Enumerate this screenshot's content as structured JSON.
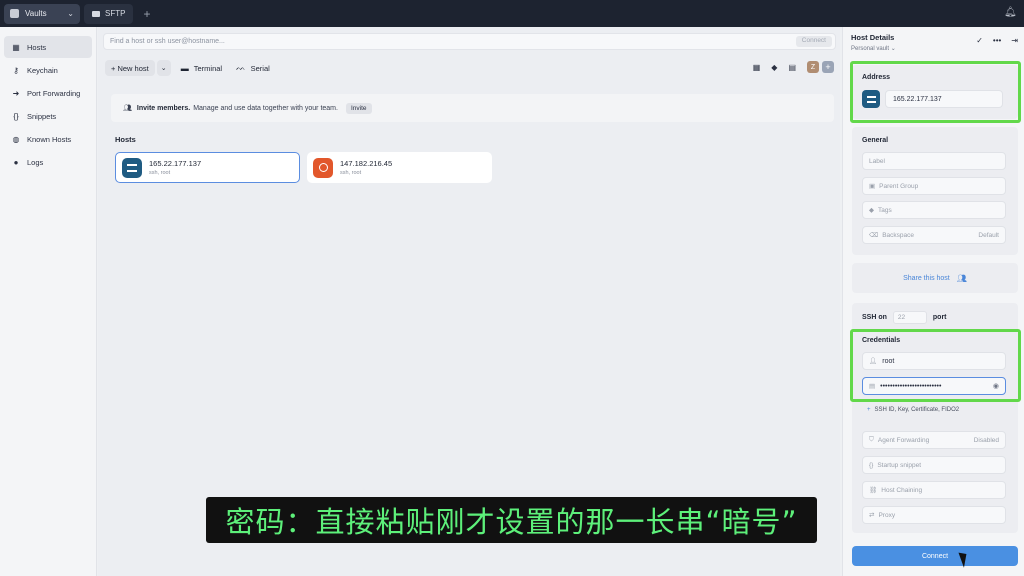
{
  "titlebar": {
    "vault_tab": "Vaults",
    "sftp_tab": "SFTP",
    "add_tab": "+"
  },
  "sidebar": {
    "items": [
      {
        "label": "Hosts",
        "icon": "grid-icon"
      },
      {
        "label": "Keychain",
        "icon": "key-icon"
      },
      {
        "label": "Port Forwarding",
        "icon": "arrow-forward-icon"
      },
      {
        "label": "Snippets",
        "icon": "braces-icon"
      },
      {
        "label": "Known Hosts",
        "icon": "globe-icon"
      },
      {
        "label": "Logs",
        "icon": "clock-icon"
      }
    ]
  },
  "main": {
    "search_placeholder": "Find a host or ssh user@hostname...",
    "search_connect": "Connect",
    "new_host": "+ New host",
    "terminal": "Terminal",
    "serial": "Serial",
    "avatar_letter": "Z",
    "invite_bold": "Invite members.",
    "invite_text": "Manage and use data together with your team.",
    "invite_button": "Invite",
    "hosts_label": "Hosts",
    "hosts": [
      {
        "ip": "165.22.177.137",
        "sub": "ssh, root"
      },
      {
        "ip": "147.182.216.45",
        "sub": "ssh, root"
      }
    ]
  },
  "panel": {
    "title": "Host Details",
    "vault": "Personal vault",
    "address_label": "Address",
    "address_value": "165.22.177.137",
    "general_label": "General",
    "label_placeholder": "Label",
    "parent_group": "Parent Group",
    "tags": "Tags",
    "backspace": "Backspace",
    "backspace_value": "Default",
    "share": "Share this host",
    "ssh_on": "SSH on",
    "port_placeholder": "22",
    "port_word": "port",
    "credentials_label": "Credentials",
    "username": "root",
    "password_mask": "•••••••••••••••••••••••••",
    "ssh_id_text": "SSH ID, Key, Certificate, FIDO2",
    "agent_forwarding": "Agent Forwarding",
    "agent_forwarding_value": "Disabled",
    "startup_snippet": "Startup snippet",
    "host_chaining": "Host Chaining",
    "proxy": "Proxy",
    "connect": "Connect"
  },
  "overlay": {
    "subtitle": "密码：直接粘贴刚才设置的那一长串“暗号”"
  },
  "colors": {
    "highlight": "#62d84a",
    "accent": "#4a90e2",
    "titlebar": "#1d2330"
  }
}
